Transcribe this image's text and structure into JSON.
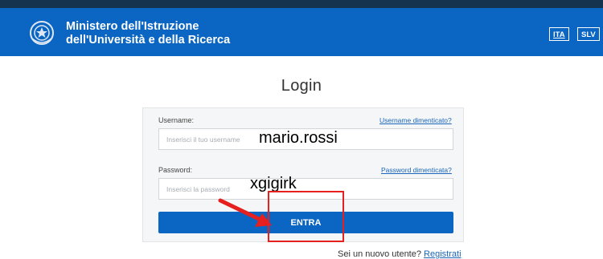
{
  "header": {
    "ministry_line1": "Ministero dell'Istruzione",
    "ministry_line2": "dell'Università e della Ricerca",
    "lang_ita": "ITA",
    "lang_slv": "SLV",
    "bar_color": "#0b66c3",
    "top_stripe_color": "#15324f"
  },
  "login": {
    "title": "Login",
    "username_label": "Username:",
    "forgot_username": "Username dimenticato?",
    "username_placeholder": "Inserisci il tuo username",
    "username_value": "mario.rossi",
    "password_label": "Password:",
    "forgot_password": "Password dimenticata?",
    "password_placeholder": "Inserisci la password",
    "password_value": "xgigirk",
    "submit_label": "ENTRA",
    "new_user_text": "Sei un nuovo utente?",
    "register_link": "Registrati"
  },
  "annotations": {
    "highlight_color": "#e5201f",
    "arrow_color": "#e5201f"
  }
}
